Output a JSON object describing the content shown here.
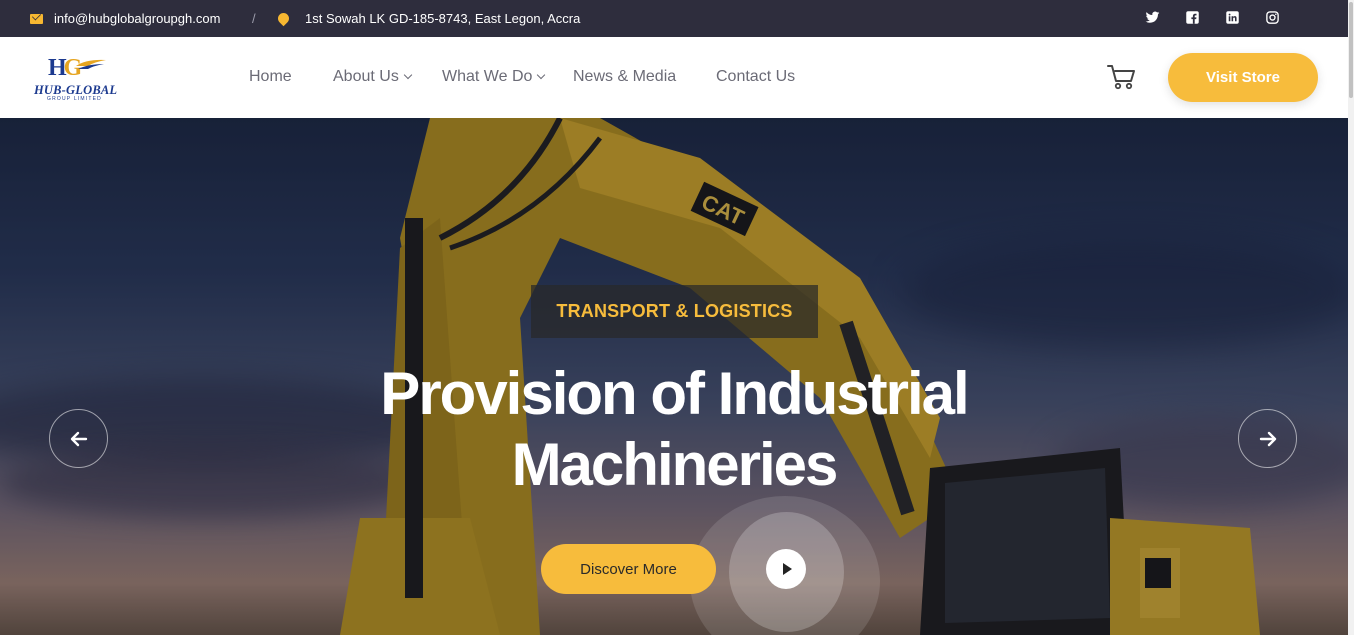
{
  "topbar": {
    "email": "info@hubglobalgroupgh.com",
    "separator": "/",
    "address": "1st Sowah LK GD-185-8743, East Legon, Accra",
    "social_icons": [
      "twitter-icon",
      "facebook-icon",
      "linkedin-icon",
      "instagram-icon"
    ]
  },
  "logo": {
    "mark": "HG",
    "name": "HUB-GLOBAL",
    "tagline": "GROUP LIMITED"
  },
  "nav": {
    "items": [
      {
        "label": "Home"
      },
      {
        "label": "About Us"
      },
      {
        "label": "What We Do"
      },
      {
        "label": "News & Media"
      },
      {
        "label": "Contact Us"
      }
    ]
  },
  "header": {
    "cart_icon": "shopping-cart-icon",
    "visit_store": "Visit Store"
  },
  "hero": {
    "tag": "TRANSPORT & LOGISTICS",
    "headline_line1": "Provision of Industrial",
    "headline_line2": "Machineries",
    "discover": "Discover More",
    "play_icon": "play-icon",
    "prev_icon": "arrow-left-icon",
    "next_icon": "arrow-right-icon"
  },
  "colors": {
    "accent": "#f7bc3c",
    "topbar_bg": "#2e2d3d",
    "nav_text": "#6b6b76",
    "brand_blue": "#1c3a8f"
  }
}
